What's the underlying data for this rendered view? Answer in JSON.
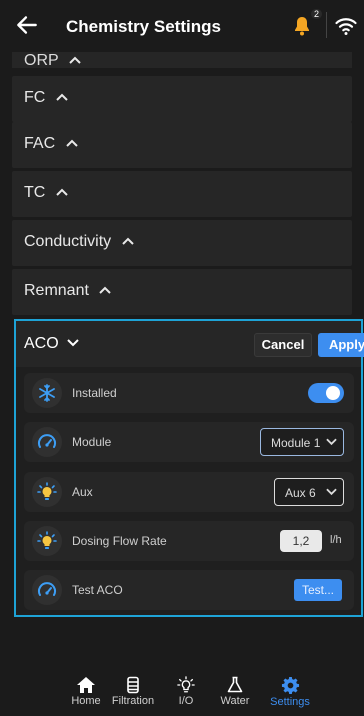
{
  "header": {
    "title": "Chemistry Settings",
    "back_icon": "arrow-left-icon",
    "notification_count": "2",
    "bell_color": "#f5a623",
    "wifi_icon": "wifi-icon"
  },
  "sections": {
    "orp": "ORP",
    "fc": "FC",
    "fac": "FAC",
    "tc": "TC",
    "conductivity": "Conductivity",
    "remnant": "Remnant"
  },
  "aco": {
    "title": "ACO",
    "cancel_label": "Cancel",
    "apply_label": "Apply",
    "accent": "#1ea3d6",
    "items": {
      "installed": {
        "label": "Installed",
        "toggle_on": true,
        "icon": "snowflake-icon"
      },
      "module": {
        "label": "Module",
        "value": "Module 1",
        "icon": "gauge-icon"
      },
      "aux": {
        "label": "Aux",
        "value": "Aux 6",
        "icon": "lightbulb-icon"
      },
      "dosing": {
        "label": "Dosing Flow Rate",
        "value": "1,2",
        "unit": "l/h",
        "icon": "lightbulb-icon"
      },
      "test": {
        "label": "Test ACO",
        "button": "Test...",
        "icon": "gauge-icon"
      }
    }
  },
  "nav": {
    "home": "Home",
    "filtration": "Filtration",
    "io": "I/O",
    "water": "Water",
    "settings": "Settings",
    "active": "settings",
    "active_color": "#3d8ef0"
  }
}
